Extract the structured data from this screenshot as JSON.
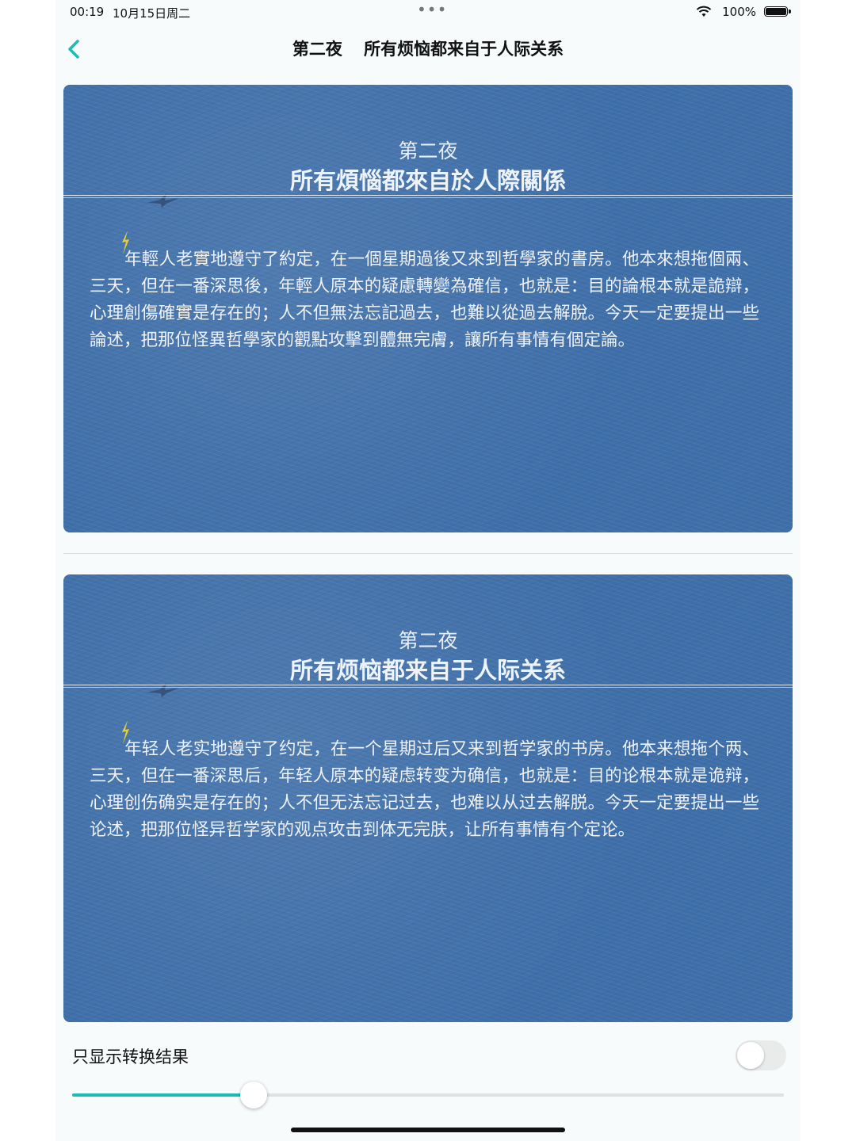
{
  "status_bar": {
    "time": "00:19",
    "date": "10月15日周二",
    "dots": "•••",
    "wifi_icon": "wifi-icon",
    "battery_percent": "100%",
    "battery_icon": "battery-full-icon"
  },
  "nav": {
    "back_icon": "chevron-left-icon",
    "accent_color": "#1bbdb2",
    "title_part1": "第二夜",
    "title_part2": "所有烦恼都来自于人际关系"
  },
  "cards": [
    {
      "subtitle": "第二夜",
      "title": "所有煩惱都來自於人際關係",
      "body": "年輕人老實地遵守了約定，在一個星期過後又來到哲學家的書房。他本來想拖個兩、三天，但在一番深思後，年輕人原本的疑慮轉變為確信，也就是：目的論根本就是詭辯，心理創傷確實是存在的；人不但無法忘記過去，也難以從過去解脫。今天一定要提出一些論述，把那位怪異哲學家的觀點攻擊到體無完膚，讓所有事情有個定論。"
    },
    {
      "subtitle": "第二夜",
      "title": "所有烦恼都来自于人际关系",
      "body": "年轻人老实地遵守了约定，在一个星期过后又来到哲学家的书房。他本来想拖个两、三天，但在一番深思后，年轻人原本的疑虑转变为确信，也就是：目的论根本就是诡辩，心理创伤确实是存在的；人不但无法忘记过去，也难以从过去解脱。今天一定要提出一些论述，把那位怪异哲学家的观点攻击到体无完肤，让所有事情有个定论。"
    }
  ],
  "card_color": "#3f6fa9",
  "controls": {
    "toggle_label": "只显示转换结果",
    "toggle_on": false,
    "slider_fraction": 0.255
  }
}
